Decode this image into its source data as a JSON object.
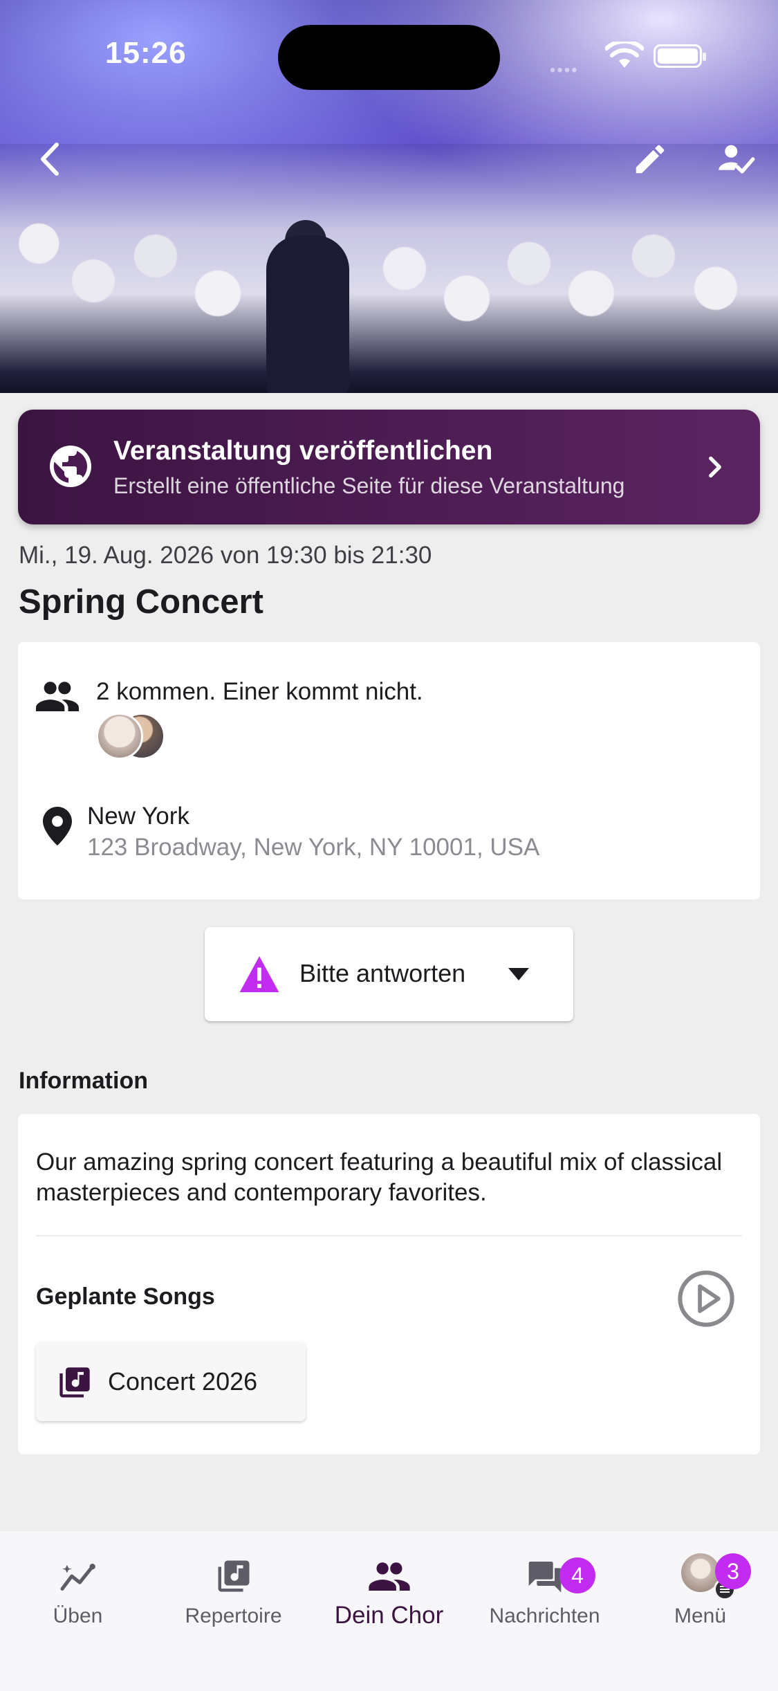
{
  "status_bar": {
    "time": "15:26"
  },
  "publish_banner": {
    "title": "Veranstaltung veröffentlichen",
    "subtitle": "Erstellt eine öffentliche Seite für diese Veranstaltung"
  },
  "event": {
    "date_time": "Mi., 19. Aug. 2026 von 19:30 bis 21:30",
    "title": "Spring Concert",
    "attendance": "2 kommen. Einer kommt nicht.",
    "location_name": "New York",
    "location_address": "123 Broadway, New York, NY 10001, USA"
  },
  "rsvp": {
    "label": "Bitte antworten"
  },
  "information": {
    "heading": "Information",
    "description": "Our amazing spring concert featuring a beautiful mix of classical masterpieces and contemporary favorites.",
    "songs_heading": "Geplante Songs",
    "setlist_label": "Concert 2026"
  },
  "bottom_nav": {
    "items": [
      {
        "label": "Üben",
        "icon": "trending-icon"
      },
      {
        "label": "Repertoire",
        "icon": "music-library-icon"
      },
      {
        "label": "Dein Chor",
        "icon": "group-icon",
        "active": true
      },
      {
        "label": "Nachrichten",
        "icon": "chat-icon",
        "badge": "4"
      },
      {
        "label": "Menü",
        "icon": "avatar",
        "badge": "3"
      }
    ]
  },
  "colors": {
    "accent": "#3c1442",
    "banner_end": "#5b2461",
    "badge": "#c22cf0",
    "warning": "#c22cf0"
  }
}
